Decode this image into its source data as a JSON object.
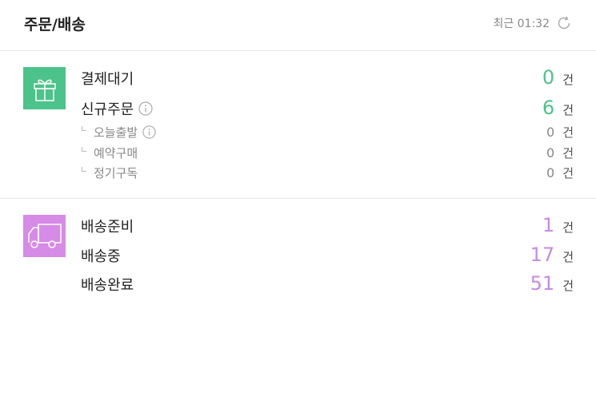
{
  "header": {
    "title": "주문/배송",
    "refresh_text": "최근 01:32"
  },
  "colors": {
    "order_accent": "#4cc38a",
    "delivery_accent": "#d68be6",
    "delivery_count": "#c98ae0"
  },
  "orders": {
    "icon": "gift-icon",
    "payment_pending": {
      "label": "결제대기",
      "count": "0",
      "unit": "건"
    },
    "new_order": {
      "label": "신규주문",
      "count": "6",
      "unit": "건"
    },
    "today_shipping": {
      "label": "오늘출발",
      "count": "0",
      "unit": "건"
    },
    "reservation": {
      "label": "예약구매",
      "count": "0",
      "unit": "건"
    },
    "subscription": {
      "label": "정기구독",
      "count": "0",
      "unit": "건"
    }
  },
  "delivery": {
    "icon": "truck-icon",
    "preparing": {
      "label": "배송준비",
      "count": "1",
      "unit": "건"
    },
    "in_transit": {
      "label": "배송중",
      "count": "17",
      "unit": "건"
    },
    "completed": {
      "label": "배송완료",
      "count": "51",
      "unit": "건"
    }
  }
}
